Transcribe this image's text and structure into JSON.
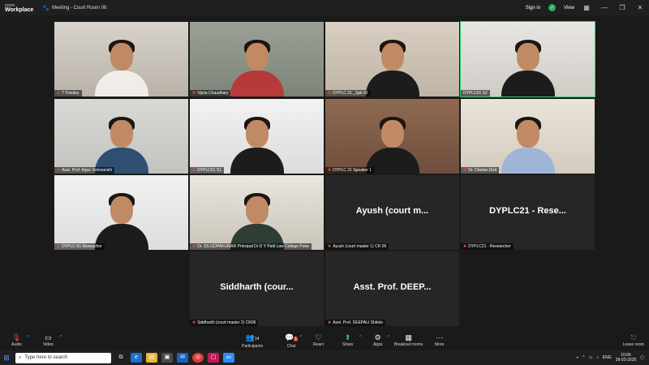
{
  "app": {
    "logo_line1": "zoom",
    "logo_line2": "Workplace",
    "meeting_title": "Meeting - Court Room 06",
    "sign_in": "Sign in",
    "view": "View"
  },
  "participants": [
    {
      "name": "T Pandey",
      "muted": true
    },
    {
      "name": "Vijeta Chaudhary",
      "muted": true
    },
    {
      "name": "DYPLC 21 _Spk 02",
      "muted": true
    },
    {
      "name": "DYPLC01 S2",
      "muted": false
    },
    {
      "name": "Asst. Prof. Arjun Somvanshi",
      "muted": true
    },
    {
      "name": "DYPLC01 S1",
      "muted": true
    },
    {
      "name": "DYPLC 21 Speaker 1",
      "muted": true
    },
    {
      "name": "Dr. Chetan Dixit",
      "muted": true
    },
    {
      "name": "DYPLC-01 Reseacher",
      "muted": true
    },
    {
      "name": "Dr. SS GOPAKUMAR Principal Dr D Y Patil Law College Pune",
      "muted": true
    },
    {
      "name": "Ayush (court master 1) CR 06",
      "big": "Ayush  (court m...",
      "muted": true
    },
    {
      "name": "DYPLC21 - Researcher",
      "big": "DYPLC21 - Rese...",
      "muted": true
    },
    {
      "name": "Siddharth (court master 2) CR06",
      "big": "Siddharth  (cour...",
      "muted": true
    },
    {
      "name": "Asst. Prof. DEEPALI Shitole",
      "big": "Asst. Prof. DEEP...",
      "muted": true
    }
  ],
  "toolbar": {
    "audio": "Audio",
    "video": "Video",
    "participants_count": "14",
    "participants": "Participants",
    "chat_badge": "1",
    "chat": "Chat",
    "react": "React",
    "share": "Share",
    "apps": "Apps",
    "breakout": "Breakout rooms",
    "more": "More",
    "leave": "Leave room"
  },
  "taskbar": {
    "search_placeholder": "Type here to search",
    "lang": "ENG",
    "time": "10:06",
    "date": "28-03-2025"
  }
}
